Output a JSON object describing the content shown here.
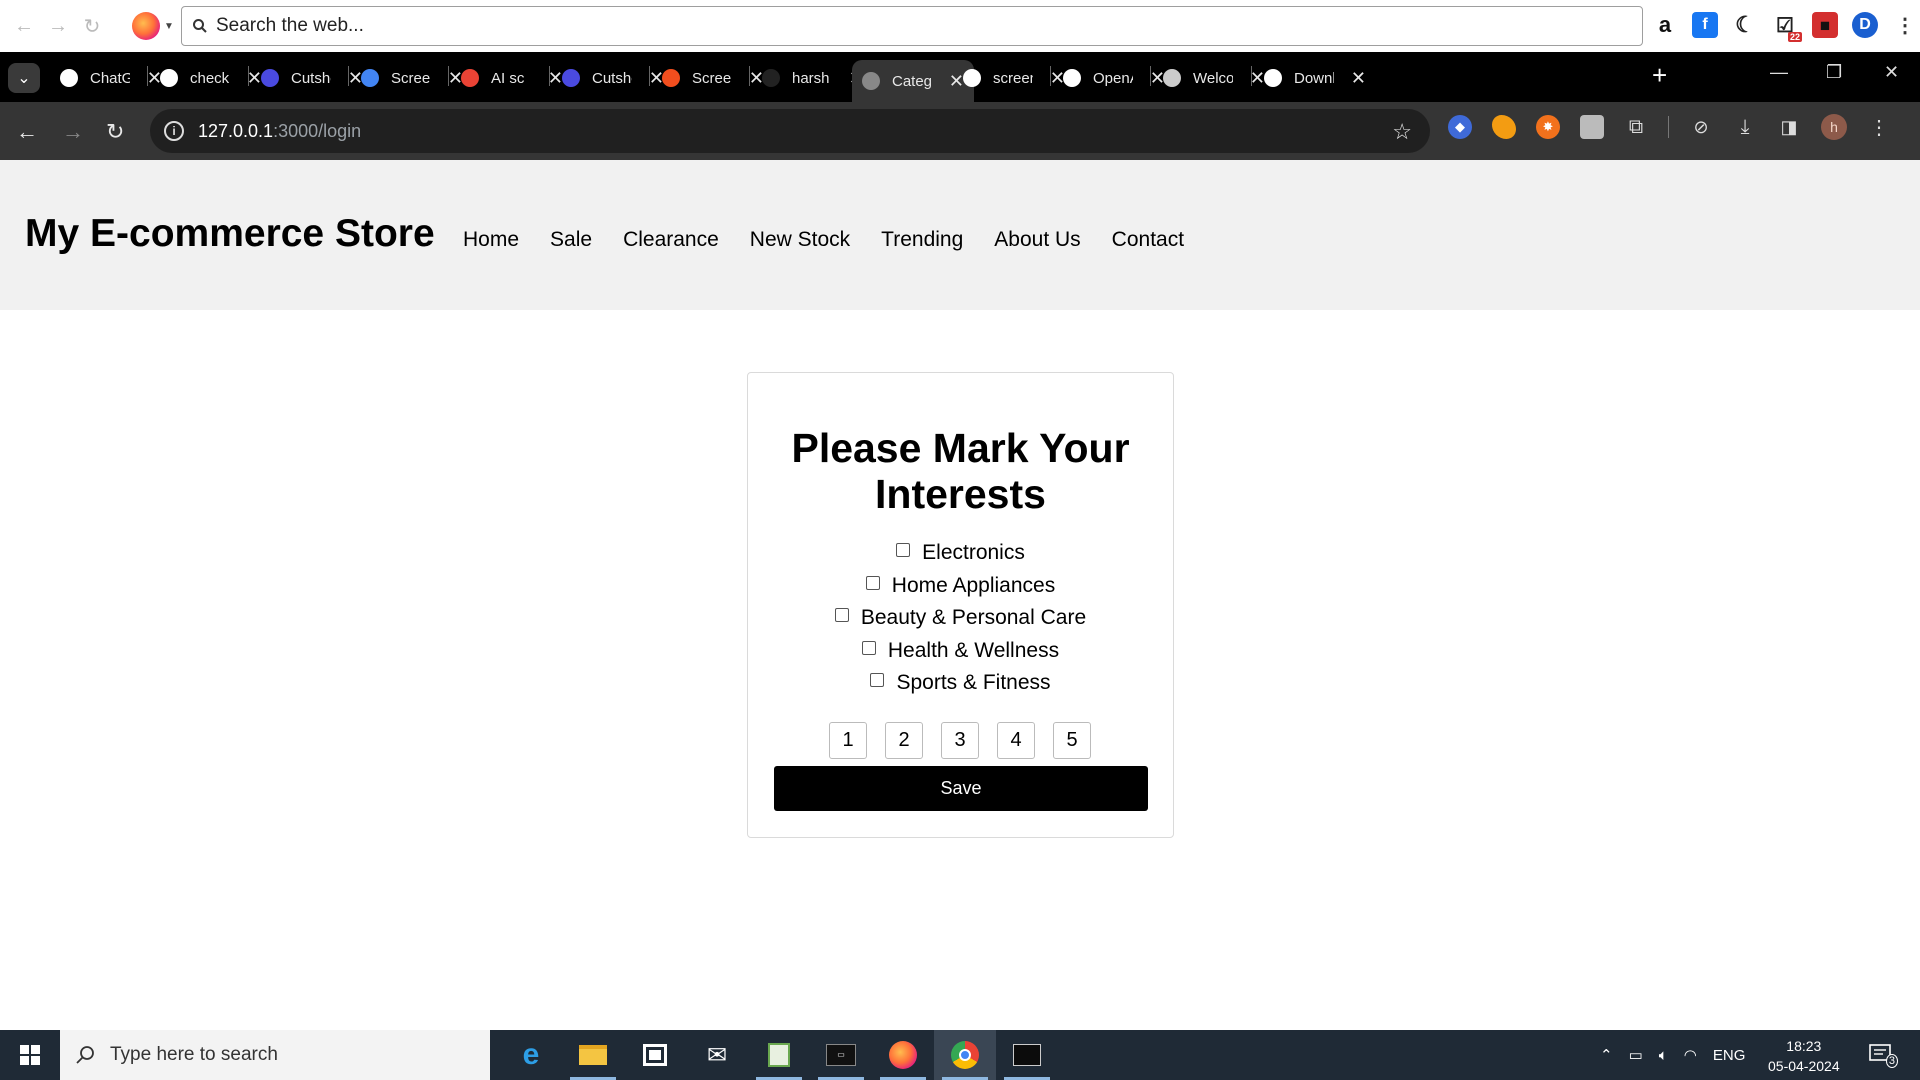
{
  "top_bar": {
    "search_placeholder": "Search the web..."
  },
  "tabs": [
    {
      "title": "ChatGPT",
      "favicon": "chatgpt-icon",
      "color": "#ffffff"
    },
    {
      "title": "check",
      "favicon": "google-icon",
      "color": "#ffffff"
    },
    {
      "title": "Cutshort",
      "favicon": "cutshort-icon",
      "color": "#4a4ae0"
    },
    {
      "title": "Screen",
      "favicon": "docs-icon",
      "color": "#4285f4"
    },
    {
      "title": "AI sc",
      "favicon": "gmail-icon",
      "color": "#ea4335"
    },
    {
      "title": "Cutshort",
      "favicon": "cutshort-icon",
      "color": "#4a4ae0"
    },
    {
      "title": "Screen",
      "favicon": "figma-icon",
      "color": "#f24e1e"
    },
    {
      "title": "harsh",
      "favicon": "github-icon",
      "color": "#222222"
    },
    {
      "title": "Categories",
      "favicon": "globe-icon",
      "color": "#888888",
      "active": true
    },
    {
      "title": "screen",
      "favicon": "google-icon",
      "color": "#ffffff"
    },
    {
      "title": "OpenAI",
      "favicon": "openai-icon",
      "color": "#ffffff"
    },
    {
      "title": "Welcome",
      "favicon": "globe-icon",
      "color": "#cccccc"
    },
    {
      "title": "Downloads",
      "favicon": "download-icon",
      "color": "#ffffff"
    }
  ],
  "address_bar": {
    "host": "127.0.0.1",
    "path": ":3000/login"
  },
  "site": {
    "title": "My E-commerce Store",
    "nav": [
      "Home",
      "Sale",
      "Clearance",
      "New Stock",
      "Trending",
      "About Us",
      "Contact"
    ]
  },
  "form": {
    "heading_line1": "Please Mark Your",
    "heading_line2": "Interests",
    "interests": [
      {
        "label": "Electronics",
        "checked": false
      },
      {
        "label": "Home Appliances",
        "checked": false
      },
      {
        "label": "Beauty & Personal Care",
        "checked": false
      },
      {
        "label": "Health & Wellness",
        "checked": false
      },
      {
        "label": "Sports & Fitness",
        "checked": false
      }
    ],
    "pages": [
      "1",
      "2",
      "3",
      "4",
      "5"
    ],
    "save_label": "Save"
  },
  "taskbar": {
    "search_placeholder": "Type here to search",
    "language": "ENG",
    "time": "18:23",
    "date": "05-04-2024",
    "notification_count": "3"
  },
  "extension_badges": {
    "todo_count": "22"
  }
}
